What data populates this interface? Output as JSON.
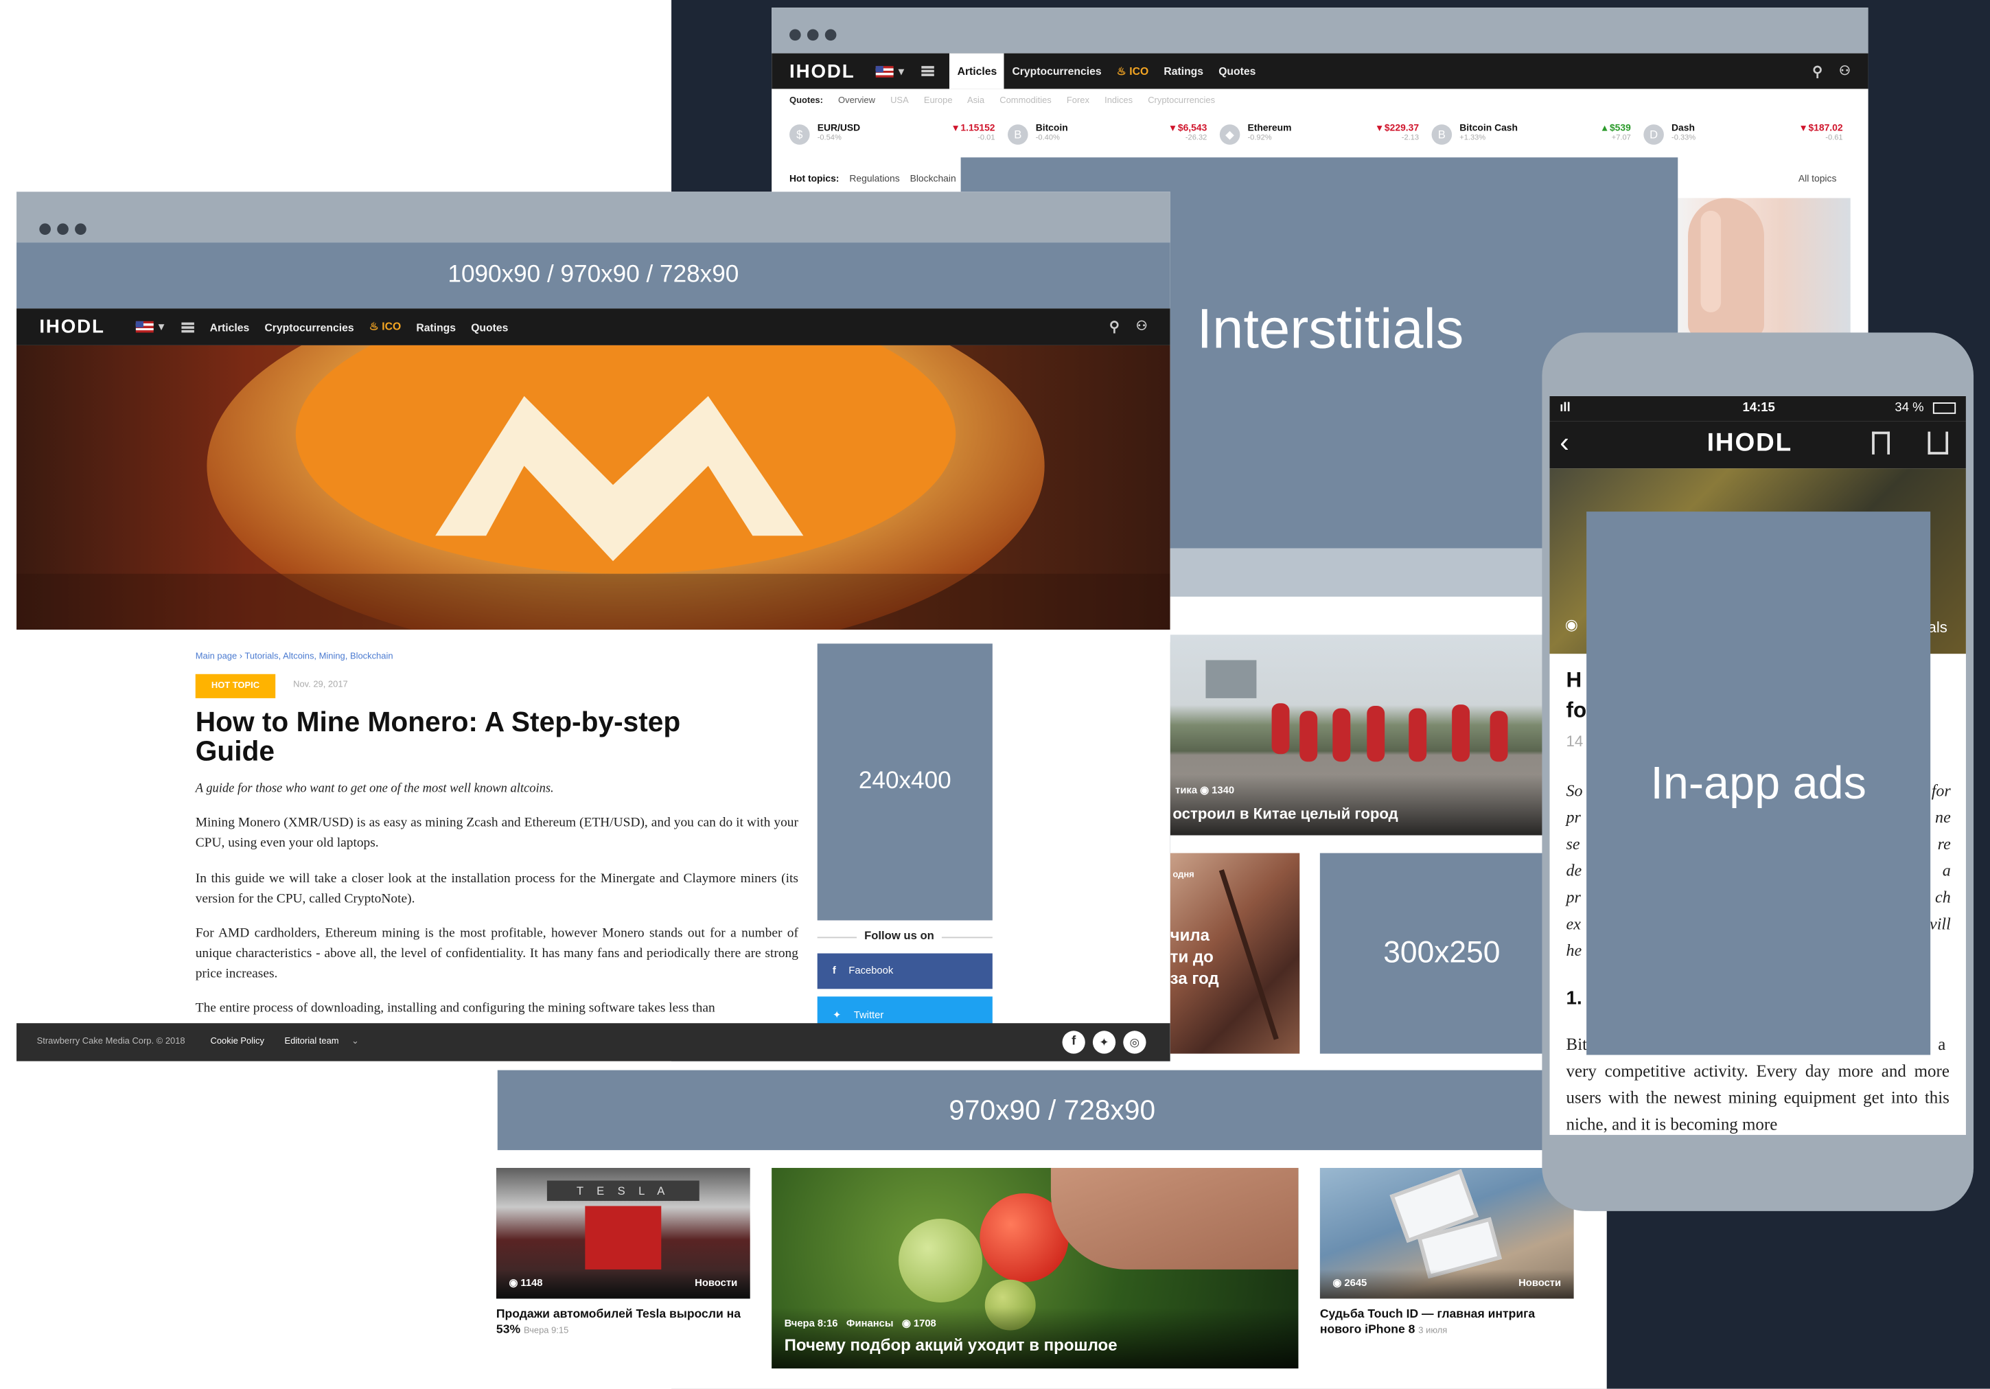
{
  "ads": {
    "top_banner": "1090x90 / 970x90 / 728x90",
    "interstitials": "Interstitials",
    "sidebar": "240x400",
    "rect": "300x250",
    "bottom_banner": "970x90 / 728x90",
    "in_app": "In-app ads"
  },
  "site": {
    "logo": "IHODL",
    "nav": [
      "Articles",
      "Cryptocurrencies",
      "ICO",
      "Ratings",
      "Quotes"
    ]
  },
  "back_window": {
    "quotes_label": "Quotes:",
    "quote_tabs": [
      "Overview",
      "USA",
      "Europe",
      "Asia",
      "Commodities",
      "Forex",
      "Indices",
      "Cryptocurrencies"
    ],
    "quotes": [
      {
        "name": "EUR/USD",
        "sub": "-0.54%",
        "value": "▾ 1.15152",
        "sub2": "-0.01",
        "color": "#d0142b"
      },
      {
        "name": "Bitcoin",
        "sub": "-0.40%",
        "value": "▾ $6,543",
        "sub2": "-26.32",
        "color": "#d0142b"
      },
      {
        "name": "Ethereum",
        "sub": "-0.92%",
        "value": "▾ $229.37",
        "sub2": "-2.13",
        "color": "#d0142b"
      },
      {
        "name": "Bitcoin Cash",
        "sub": "+1.33%",
        "value": "▴ $539",
        "sub2": "+7.07",
        "color": "#2a9a2a"
      },
      {
        "name": "Dash",
        "sub": "-0.33%",
        "value": "▾ $187.02",
        "sub2": "-0.61",
        "color": "#d0142b"
      }
    ],
    "hot_topics_label": "Hot topics:",
    "hot_topics": [
      "Regulations",
      "Blockchain"
    ],
    "all_topics": "All topics",
    "card1_stats": "тика  ◉ 1340",
    "card1_title": "остроил в Китае целый город",
    "card2_title": "чила\nти до\nза год",
    "card2_tag": "одня"
  },
  "article": {
    "breadcrumb_home": "Main page",
    "breadcrumb_rest": "Tutorials, Altcoins, Mining, Blockchain",
    "badge": "HOT TOPIC",
    "date": "Nov. 29, 2017",
    "title": "How to Mine Monero: A Step-by-step Guide",
    "lead": "A guide for those who want to get one of the most well known altcoins.",
    "p1": "Mining Monero (XMR/USD) is as easy as mining Zcash and Ethereum (ETH/USD), and you can do it with your CPU, using even your old laptops.",
    "p2": "In this guide we will take a closer look at the installation process for the Minergate and Claymore miners (its version for the CPU, called CryptoNote).",
    "p3": "For AMD cardholders, Ethereum mining is the most profitable, however Monero stands out for a number of unique characteristics - above all, the level of confidentiality. It has many fans and periodically there are strong price increases.",
    "p4": "The entire process of downloading, installing and configuring the mining software takes less than",
    "follow": "Follow us on",
    "facebook": "Facebook",
    "twitter": "Twitter",
    "footer_copy": "Strawberry Cake Media Corp. © 2018",
    "footer_links": [
      "Cookie Policy",
      "Editorial team"
    ]
  },
  "cards": [
    {
      "views": "1148",
      "tag": "Новости",
      "title": "Продажи автомобилей Tesla выросли на 53%",
      "time": "Вчера 9:15"
    },
    {
      "meta": "Вчера 8:16   Финансы   ◉ 1708",
      "title": "Почему подбор акций уходит в прошлое"
    },
    {
      "views": "2645",
      "tag": "Новости",
      "title": "Судьба Touch ID — главная интрига нового iPhone 8",
      "time": "3 июля"
    }
  ],
  "phone": {
    "time": "14:15",
    "battery": "34 %",
    "logo": "IHODL",
    "left_letters": [
      "H",
      "fo",
      "14"
    ],
    "left_text": [
      "So",
      "pr",
      "se",
      "de",
      "pr",
      "ex",
      "he"
    ],
    "right_text": [
      "for",
      "ne",
      "re",
      "a",
      "ch",
      "vill"
    ],
    "heading": "1.",
    "frag_left": "Bit",
    "frag_right": "a",
    "photo_label": "als",
    "body": "very competitive activity. Every day more and more users with the newest mining equipment get into this niche, and it is becoming more"
  }
}
